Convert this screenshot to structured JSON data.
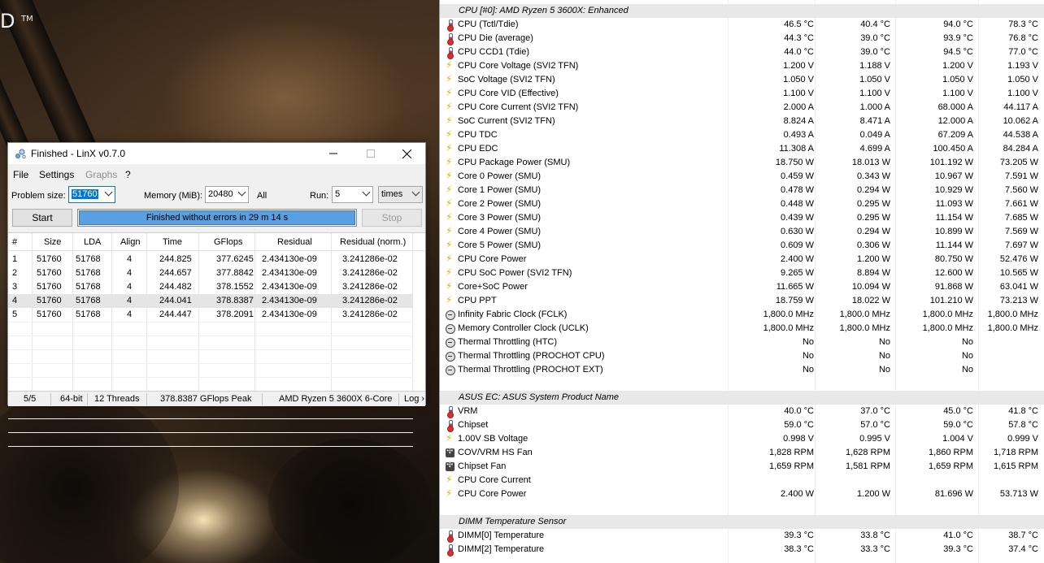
{
  "wallpaper": {
    "logo_text": "D",
    "logo_tm": "TM"
  },
  "linx": {
    "title": "Finished - LinX v0.7.0",
    "menu": [
      "File",
      "Settings",
      "Graphs",
      "?"
    ],
    "problem_size_label": "Problem size:",
    "problem_size_value": "51760",
    "memory_label": "Memory (MiB):",
    "memory_value": "20480",
    "all_label": "All",
    "run_label": "Run:",
    "run_value": "5",
    "run_unit": "times",
    "start_button": "Start",
    "stop_button": "Stop",
    "progress_text": "Finished without errors in 29 m 14 s",
    "progress_fraction": 1.0,
    "columns": [
      "#",
      "Size",
      "LDA",
      "Align",
      "Time",
      "GFlops",
      "Residual",
      "Residual (norm.)"
    ],
    "rows": [
      [
        "1",
        "51760",
        "51768",
        "4",
        "244.825",
        "377.6245",
        "2.434130e-09",
        "3.241286e-02"
      ],
      [
        "2",
        "51760",
        "51768",
        "4",
        "244.657",
        "377.8842",
        "2.434130e-09",
        "3.241286e-02"
      ],
      [
        "3",
        "51760",
        "51768",
        "4",
        "244.482",
        "378.1552",
        "2.434130e-09",
        "3.241286e-02"
      ],
      [
        "4",
        "51760",
        "51768",
        "4",
        "244.041",
        "378.8387",
        "2.434130e-09",
        "3.241286e-02"
      ],
      [
        "5",
        "51760",
        "51768",
        "4",
        "244.447",
        "378.2091",
        "2.434130e-09",
        "3.241286e-02"
      ]
    ],
    "selected_row": 3,
    "status": {
      "runs": "5/5",
      "bits": "64-bit",
      "threads": "12 Threads",
      "peak": "378.8387 GFlops Peak",
      "cpu": "AMD Ryzen 5 3600X 6-Core",
      "log": "Log ›"
    }
  },
  "hwinfo": {
    "rows": [
      {
        "type": "group",
        "name": "CPU [#0]: AMD Ryzen 5 3600X: Enhanced"
      },
      {
        "type": "temp",
        "name": "CPU (Tctl/Tdie)",
        "v": [
          "46.5 °C",
          "40.4 °C",
          "94.0 °C",
          "78.3 °C"
        ]
      },
      {
        "type": "temp",
        "name": "CPU Die (average)",
        "v": [
          "44.3 °C",
          "39.0 °C",
          "93.9 °C",
          "76.8 °C"
        ]
      },
      {
        "type": "temp",
        "name": "CPU CCD1 (Tdie)",
        "v": [
          "44.0 °C",
          "39.0 °C",
          "94.5 °C",
          "77.0 °C"
        ]
      },
      {
        "type": "volt",
        "name": "CPU Core Voltage (SVI2 TFN)",
        "v": [
          "1.200 V",
          "1.188 V",
          "1.200 V",
          "1.193 V"
        ]
      },
      {
        "type": "volt",
        "name": "SoC Voltage (SVI2 TFN)",
        "v": [
          "1.050 V",
          "1.050 V",
          "1.050 V",
          "1.050 V"
        ]
      },
      {
        "type": "volt",
        "name": "CPU Core VID (Effective)",
        "v": [
          "1.100 V",
          "1.100 V",
          "1.100 V",
          "1.100 V"
        ]
      },
      {
        "type": "volt",
        "name": "CPU Core Current (SVI2 TFN)",
        "v": [
          "2.000 A",
          "1.000 A",
          "68.000 A",
          "44.117 A"
        ]
      },
      {
        "type": "volt",
        "name": "SoC Current (SVI2 TFN)",
        "v": [
          "8.824 A",
          "8.471 A",
          "12.000 A",
          "10.062 A"
        ]
      },
      {
        "type": "volt",
        "name": "CPU TDC",
        "v": [
          "0.493 A",
          "0.049 A",
          "67.209 A",
          "44.538 A"
        ]
      },
      {
        "type": "volt",
        "name": "CPU EDC",
        "v": [
          "11.308 A",
          "4.699 A",
          "100.450 A",
          "84.284 A"
        ]
      },
      {
        "type": "volt",
        "name": "CPU Package Power (SMU)",
        "v": [
          "18.750 W",
          "18.013 W",
          "101.192 W",
          "73.205 W"
        ]
      },
      {
        "type": "volt",
        "name": "Core 0 Power (SMU)",
        "v": [
          "0.459 W",
          "0.343 W",
          "10.967 W",
          "7.591 W"
        ]
      },
      {
        "type": "volt",
        "name": "Core 1 Power (SMU)",
        "v": [
          "0.478 W",
          "0.294 W",
          "10.929 W",
          "7.560 W"
        ]
      },
      {
        "type": "volt",
        "name": "Core 2 Power (SMU)",
        "v": [
          "0.448 W",
          "0.295 W",
          "11.093 W",
          "7.661 W"
        ]
      },
      {
        "type": "volt",
        "name": "Core 3 Power (SMU)",
        "v": [
          "0.439 W",
          "0.295 W",
          "11.154 W",
          "7.685 W"
        ]
      },
      {
        "type": "volt",
        "name": "Core 4 Power (SMU)",
        "v": [
          "0.630 W",
          "0.294 W",
          "10.899 W",
          "7.569 W"
        ]
      },
      {
        "type": "volt",
        "name": "Core 5 Power (SMU)",
        "v": [
          "0.609 W",
          "0.306 W",
          "11.144 W",
          "7.697 W"
        ]
      },
      {
        "type": "volt",
        "name": "CPU Core Power",
        "v": [
          "2.400 W",
          "1.200 W",
          "80.750 W",
          "52.476 W"
        ]
      },
      {
        "type": "volt",
        "name": "CPU SoC Power (SVI2 TFN)",
        "v": [
          "9.265 W",
          "8.894 W",
          "12.600 W",
          "10.565 W"
        ]
      },
      {
        "type": "volt",
        "name": "Core+SoC Power",
        "v": [
          "11.665 W",
          "10.094 W",
          "91.868 W",
          "63.041 W"
        ]
      },
      {
        "type": "volt",
        "name": "CPU PPT",
        "v": [
          "18.759 W",
          "18.022 W",
          "101.210 W",
          "73.213 W"
        ]
      },
      {
        "type": "clock",
        "name": "Infinity Fabric Clock (FCLK)",
        "v": [
          "1,800.0 MHz",
          "1,800.0 MHz",
          "1,800.0 MHz",
          "1,800.0 MHz"
        ]
      },
      {
        "type": "clock",
        "name": "Memory Controller Clock (UCLK)",
        "v": [
          "1,800.0 MHz",
          "1,800.0 MHz",
          "1,800.0 MHz",
          "1,800.0 MHz"
        ]
      },
      {
        "type": "clock",
        "name": "Thermal Throttling (HTC)",
        "v": [
          "No",
          "No",
          "No",
          ""
        ]
      },
      {
        "type": "clock",
        "name": "Thermal Throttling (PROCHOT CPU)",
        "v": [
          "No",
          "No",
          "No",
          ""
        ]
      },
      {
        "type": "clock",
        "name": "Thermal Throttling (PROCHOT EXT)",
        "v": [
          "No",
          "No",
          "No",
          ""
        ]
      },
      {
        "type": "blank"
      },
      {
        "type": "group",
        "name": "ASUS EC: ASUS System Product Name"
      },
      {
        "type": "temp",
        "name": "VRM",
        "v": [
          "40.0 °C",
          "37.0 °C",
          "45.0 °C",
          "41.8 °C"
        ]
      },
      {
        "type": "temp",
        "name": "Chipset",
        "v": [
          "59.0 °C",
          "57.0 °C",
          "59.0 °C",
          "57.8 °C"
        ]
      },
      {
        "type": "volt",
        "name": "1.00V SB Voltage",
        "v": [
          "0.998 V",
          "0.995 V",
          "1.004 V",
          "0.999 V"
        ]
      },
      {
        "type": "fan",
        "name": "COV/VRM HS Fan",
        "v": [
          "1,828 RPM",
          "1,628 RPM",
          "1,860 RPM",
          "1,718 RPM"
        ]
      },
      {
        "type": "fan",
        "name": "Chipset Fan",
        "v": [
          "1,659 RPM",
          "1,581 RPM",
          "1,659 RPM",
          "1,615 RPM"
        ]
      },
      {
        "type": "volt",
        "name": "CPU Core Current",
        "v": [
          "",
          "",
          "",
          ""
        ]
      },
      {
        "type": "volt",
        "name": "CPU Core Power",
        "v": [
          "2.400 W",
          "1.200 W",
          "81.696 W",
          "53.713 W"
        ]
      },
      {
        "type": "blank"
      },
      {
        "type": "group",
        "name": "DIMM Temperature Sensor"
      },
      {
        "type": "temp",
        "name": "DIMM[0] Temperature",
        "v": [
          "39.3 °C",
          "33.8 °C",
          "41.0 °C",
          "38.7 °C"
        ]
      },
      {
        "type": "temp",
        "name": "DIMM[2] Temperature",
        "v": [
          "38.3 °C",
          "33.3 °C",
          "39.3 °C",
          "37.4 °C"
        ]
      }
    ]
  }
}
